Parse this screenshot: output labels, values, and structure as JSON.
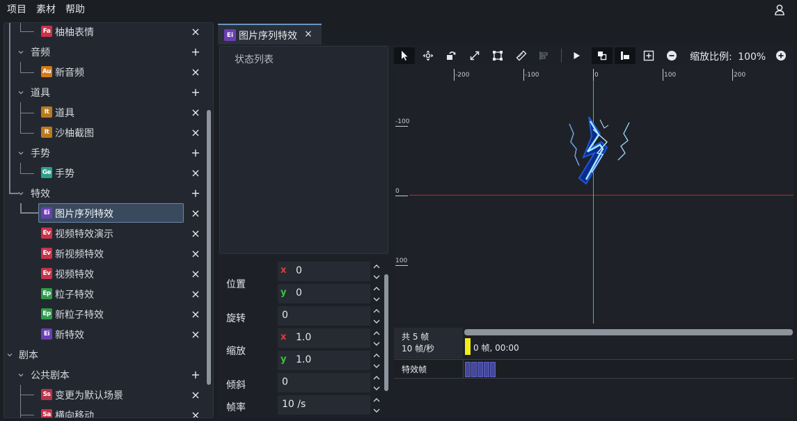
{
  "menubar": {
    "items": [
      "项目",
      "素材",
      "帮助"
    ],
    "user_icon": "user-icon"
  },
  "tree": {
    "items": [
      {
        "label": "柚柚表情",
        "badge": "Fa",
        "badge_color": "#c8334a",
        "action": "×"
      },
      {
        "label": "音频",
        "group": true,
        "action": "+"
      },
      {
        "label": "新音频",
        "badge": "Au",
        "badge_color": "#d47a18",
        "action": "×"
      },
      {
        "label": "道具",
        "group": true,
        "action": "+"
      },
      {
        "label": "道具",
        "badge": "It",
        "badge_color": "#b97a1e",
        "action": "×"
      },
      {
        "label": "沙柚截图",
        "badge": "It",
        "badge_color": "#b97a1e",
        "action": "×"
      },
      {
        "label": "手势",
        "group": true,
        "action": "+"
      },
      {
        "label": "手势",
        "badge": "Ge",
        "badge_color": "#2d9f8c",
        "action": "×"
      },
      {
        "label": "特效",
        "group": true,
        "action": "+"
      },
      {
        "label": "图片序列特效",
        "badge": "Ei",
        "badge_color": "#6a3fb3",
        "action": "×",
        "selected": true
      },
      {
        "label": "视频特效演示",
        "badge": "Ev",
        "badge_color": "#c8334a",
        "action": "×"
      },
      {
        "label": "新视频特效",
        "badge": "Ev",
        "badge_color": "#c8334a",
        "action": "×"
      },
      {
        "label": "视频特效",
        "badge": "Ev",
        "badge_color": "#c8334a",
        "action": "×"
      },
      {
        "label": "粒子特效",
        "badge": "Ep",
        "badge_color": "#2f9a4b",
        "action": "×"
      },
      {
        "label": "新粒子特效",
        "badge": "Ep",
        "badge_color": "#2f9a4b",
        "action": "×"
      },
      {
        "label": "新特效",
        "badge": "Ei",
        "badge_color": "#6a3fb3",
        "action": "×"
      },
      {
        "label": "剧本",
        "group": true,
        "top": true
      },
      {
        "label": "公共剧本",
        "group": true,
        "action": "+"
      },
      {
        "label": "变更为默认场景",
        "badge": "Ss",
        "badge_color": "#b8324b",
        "action": "×"
      },
      {
        "label": "横向移动",
        "badge": "Sa",
        "badge_color": "#c8334a",
        "action": "×"
      }
    ]
  },
  "tab": {
    "badge": "Ei",
    "label": "图片序列特效",
    "close": "×"
  },
  "state_panel": {
    "title": "状态列表"
  },
  "properties": {
    "position_label": "位置",
    "position_x": "0",
    "position_y": "0",
    "rotation_label": "旋转",
    "rotation": "0",
    "scale_label": "缩放",
    "scale_x": "1.0",
    "scale_y": "1.0",
    "skew_label": "倾斜",
    "skew": "0",
    "framerate_label": "帧率",
    "framerate": "10 /s",
    "axis_x": "x",
    "axis_y": "y"
  },
  "toolbar": {
    "tools": [
      "select-tool-icon",
      "move-tool-icon",
      "rotate-tool-icon",
      "scale-tool-icon",
      "rect-tool-icon",
      "ruler-tool-icon",
      "align-tool-icon",
      "play-icon",
      "layer-front-icon",
      "layer-back-icon",
      "fit-icon",
      "zoom-out-icon",
      "zoom-in-icon"
    ],
    "zoom_label": "缩放比例:",
    "zoom_value": "100%"
  },
  "canvas": {
    "x_ticks": [
      "-200",
      "-100",
      "0",
      "100",
      "200"
    ],
    "y_ticks": [
      "-100",
      "0",
      "100"
    ],
    "x_axis_color": "#d42020",
    "y_axis_color": "#33d633"
  },
  "timeline": {
    "frames_total": "共 5 帧",
    "fps": "10 帧/秒",
    "position": "0 帧, 00:00",
    "track_label": "特效帧",
    "frame_count": 5,
    "cursor_color": "#f2ee16"
  }
}
